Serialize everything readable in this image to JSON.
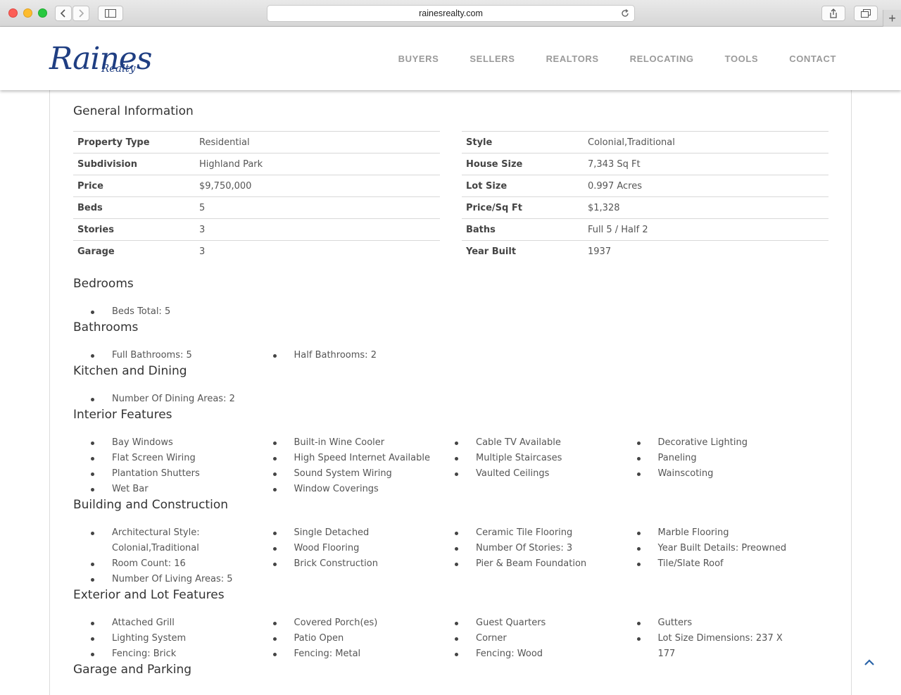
{
  "browser": {
    "url": "rainesrealty.com"
  },
  "brand": {
    "logo_script": "Raines",
    "logo_sub": "Realty",
    "color": "#1f3e82"
  },
  "nav": {
    "items": [
      "BUYERS",
      "SELLERS",
      "REALTORS",
      "RELOCATING",
      "TOOLS",
      "CONTACT"
    ]
  },
  "general": {
    "title": "General Information",
    "left": [
      {
        "label": "Property Type",
        "value": "Residential"
      },
      {
        "label": "Subdivision",
        "value": "Highland Park"
      },
      {
        "label": "Price",
        "value": "$9,750,000"
      },
      {
        "label": "Beds",
        "value": "5"
      },
      {
        "label": "Stories",
        "value": "3"
      },
      {
        "label": "Garage",
        "value": "3"
      }
    ],
    "right": [
      {
        "label": "Style",
        "value": "Colonial,Traditional"
      },
      {
        "label": "House Size",
        "value": "7,343 Sq Ft"
      },
      {
        "label": "Lot Size",
        "value": "0.997 Acres"
      },
      {
        "label": "Price/Sq Ft",
        "value": "$1,328"
      },
      {
        "label": "Baths",
        "value": "Full 5 / Half 2"
      },
      {
        "label": "Year Built",
        "value": "1937"
      }
    ]
  },
  "sections": [
    {
      "title": "Bedrooms",
      "columns": [
        [
          "Beds Total: 5"
        ],
        [],
        [],
        []
      ]
    },
    {
      "title": "Bathrooms",
      "columns": [
        [
          "Full Bathrooms: 5"
        ],
        [
          "Half Bathrooms: 2"
        ],
        [],
        []
      ]
    },
    {
      "title": "Kitchen and Dining",
      "columns": [
        [
          "Number Of Dining Areas: 2"
        ],
        [],
        [],
        []
      ]
    },
    {
      "title": "Interior Features",
      "columns": [
        [
          "Bay Windows",
          "Flat Screen Wiring",
          "Plantation Shutters",
          "Wet Bar"
        ],
        [
          "Built-in Wine Cooler",
          "High Speed Internet Available",
          "Sound System Wiring",
          "Window Coverings"
        ],
        [
          "Cable TV Available",
          "Multiple Staircases",
          "Vaulted Ceilings"
        ],
        [
          "Decorative Lighting",
          "Paneling",
          "Wainscoting"
        ]
      ]
    },
    {
      "title": "Building and Construction",
      "columns": [
        [
          "Architectural Style: Colonial,Traditional",
          "Room Count: 16",
          "Number Of Living Areas: 5"
        ],
        [
          "Single Detached",
          "Wood Flooring",
          "Brick Construction"
        ],
        [
          "Ceramic Tile Flooring",
          "Number Of Stories: 3",
          "Pier & Beam Foundation"
        ],
        [
          "Marble Flooring",
          "Year Built Details: Preowned",
          "Tile/Slate Roof"
        ]
      ]
    },
    {
      "title": "Exterior and Lot Features",
      "columns": [
        [
          "Attached Grill",
          "Lighting System",
          "Fencing: Brick"
        ],
        [
          "Covered Porch(es)",
          "Patio Open",
          "Fencing: Metal"
        ],
        [
          "Guest Quarters",
          "Corner",
          "Fencing: Wood"
        ],
        [
          "Gutters",
          "Lot Size Dimensions: 237 X 177"
        ]
      ]
    },
    {
      "title": "Garage and Parking",
      "columns": [
        [],
        [],
        [],
        []
      ]
    }
  ]
}
